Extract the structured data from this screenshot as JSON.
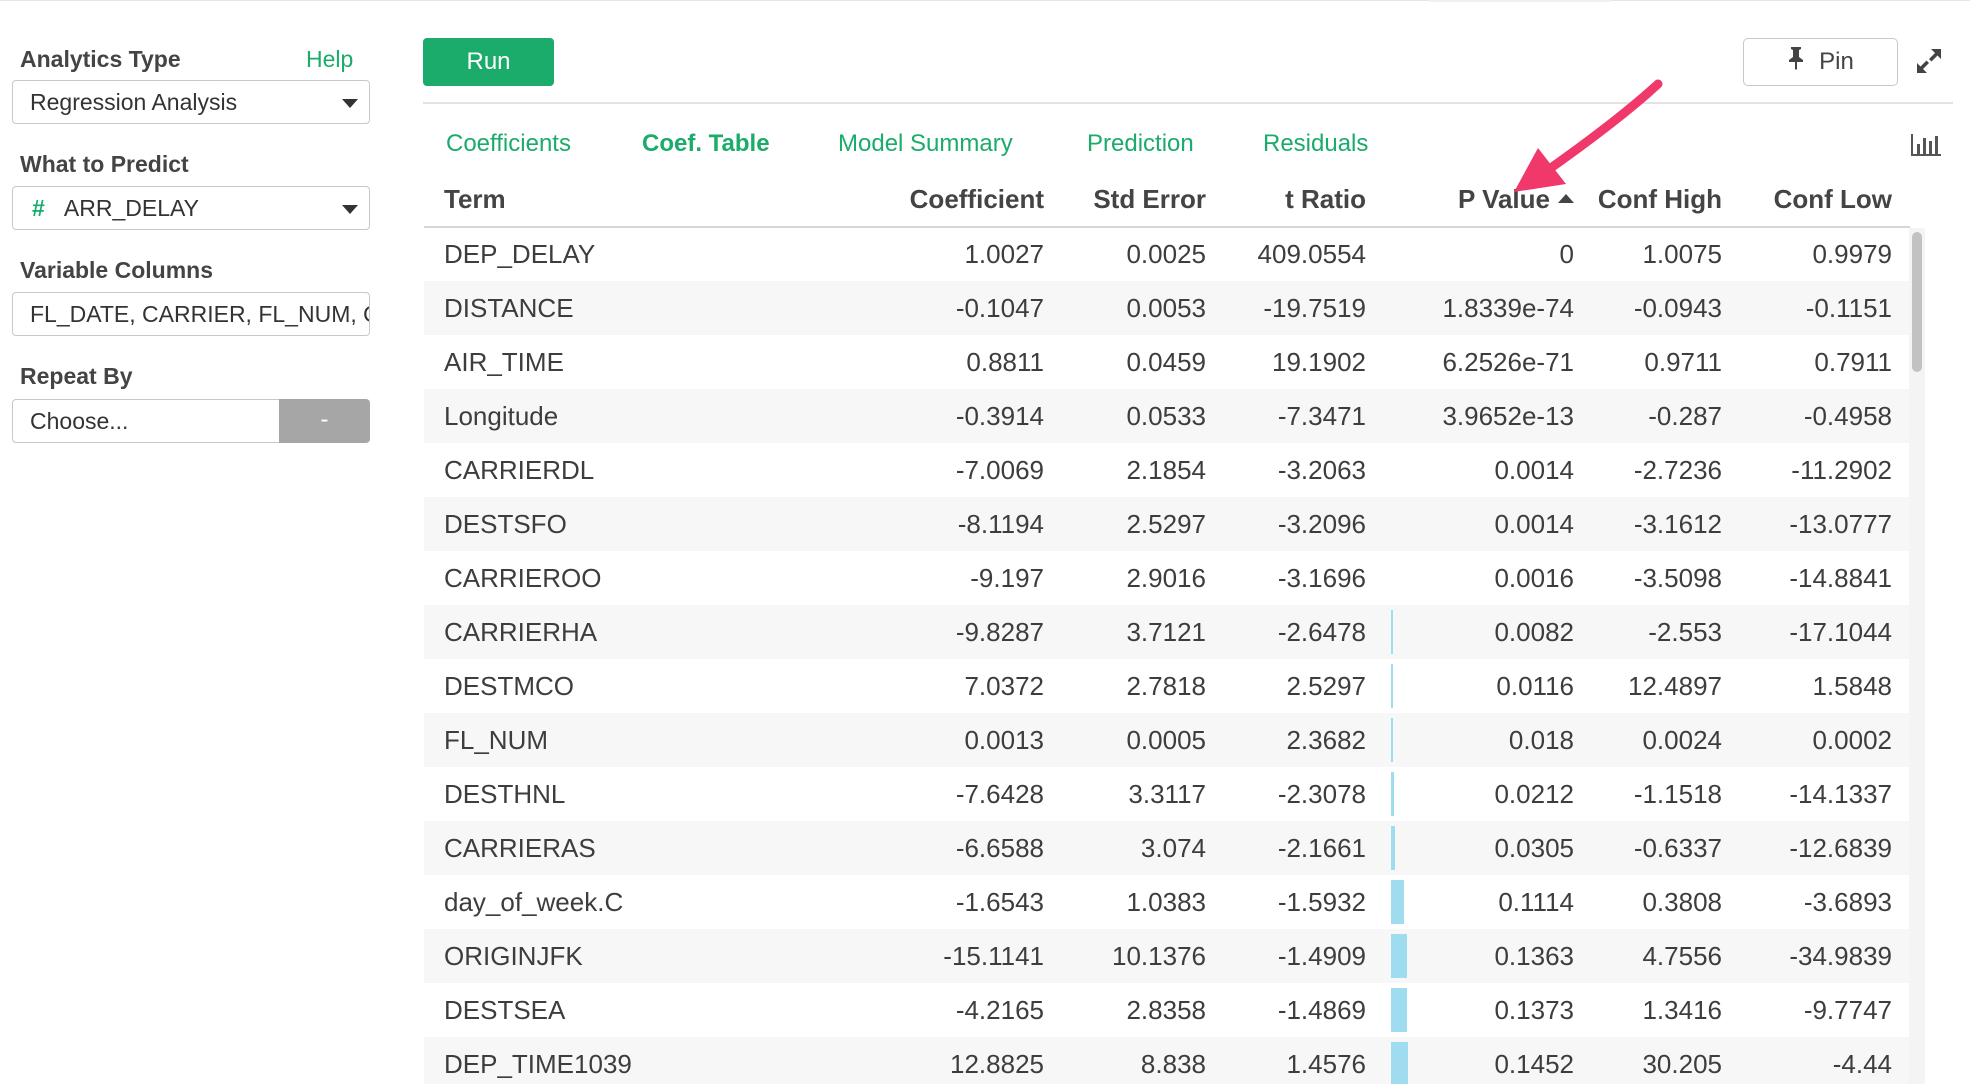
{
  "sidebar": {
    "analytics_type_label": "Analytics Type",
    "help_label": "Help",
    "analytics_type_value": "Regression Analysis",
    "predict_label": "What to Predict",
    "predict_type_glyph": "#",
    "predict_value": "ARR_DELAY",
    "variable_columns_label": "Variable Columns",
    "variable_columns_value": "FL_DATE, CARRIER, FL_NUM, ORIGIN",
    "repeat_by_label": "Repeat By",
    "repeat_by_placeholder": "Choose...",
    "repeat_by_button": "-"
  },
  "header": {
    "run_label": "Run",
    "pin_label": "Pin",
    "pin_icon": "pushpin-icon",
    "expand_icon": "expand-icon"
  },
  "tabs": [
    {
      "label": "Coefficients",
      "active": false
    },
    {
      "label": "Coef. Table",
      "active": true
    },
    {
      "label": "Model Summary",
      "active": false
    },
    {
      "label": "Prediction",
      "active": false
    },
    {
      "label": "Residuals",
      "active": false
    }
  ],
  "chart_icon": "bar-chart-icon",
  "table": {
    "columns": [
      "Term",
      "Coefficient",
      "Std Error",
      "t Ratio",
      "P Value",
      "Conf High",
      "Conf Low"
    ],
    "sorted_by": "P Value",
    "sort_direction": "ascending",
    "rows": [
      [
        "DEP_DELAY",
        "1.0027",
        "0.0025",
        "409.0554",
        "0",
        "1.0075",
        "0.9979"
      ],
      [
        "DISTANCE",
        "-0.1047",
        "0.0053",
        "-19.7519",
        "1.8339e-74",
        "-0.0943",
        "-0.1151"
      ],
      [
        "AIR_TIME",
        "0.8811",
        "0.0459",
        "19.1902",
        "6.2526e-71",
        "0.9711",
        "0.7911"
      ],
      [
        "Longitude",
        "-0.3914",
        "0.0533",
        "-7.3471",
        "3.9652e-13",
        "-0.287",
        "-0.4958"
      ],
      [
        "CARRIERDL",
        "-7.0069",
        "2.1854",
        "-3.2063",
        "0.0014",
        "-2.7236",
        "-11.2902"
      ],
      [
        "DESTSFO",
        "-8.1194",
        "2.5297",
        "-3.2096",
        "0.0014",
        "-3.1612",
        "-13.0777"
      ],
      [
        "CARRIEROO",
        "-9.197",
        "2.9016",
        "-3.1696",
        "0.0016",
        "-3.5098",
        "-14.8841"
      ],
      [
        "CARRIERHA",
        "-9.8287",
        "3.7121",
        "-2.6478",
        "0.0082",
        "-2.553",
        "-17.1044"
      ],
      [
        "DESTMCO",
        "7.0372",
        "2.7818",
        "2.5297",
        "0.0116",
        "12.4897",
        "1.5848"
      ],
      [
        "FL_NUM",
        "0.0013",
        "0.0005",
        "2.3682",
        "0.018",
        "0.0024",
        "0.0002"
      ],
      [
        "DESTHNL",
        "-7.6428",
        "3.3117",
        "-2.3078",
        "0.0212",
        "-1.1518",
        "-14.1337"
      ],
      [
        "CARRIERAS",
        "-6.6588",
        "3.074",
        "-2.1661",
        "0.0305",
        "-0.6337",
        "-12.6839"
      ],
      [
        "day_of_week.C",
        "-1.6543",
        "1.0383",
        "-1.5932",
        "0.1114",
        "0.3808",
        "-3.6893"
      ],
      [
        "ORIGINJFK",
        "-15.1141",
        "10.1376",
        "-1.4909",
        "0.1363",
        "4.7556",
        "-34.9839"
      ],
      [
        "DESTSEA",
        "-4.2165",
        "2.8358",
        "-1.4869",
        "0.1373",
        "1.3416",
        "-9.7747"
      ],
      [
        "DEP_TIME1039",
        "12.8825",
        "8.838",
        "1.4576",
        "0.1452",
        "30.205",
        "-4.44"
      ]
    ]
  },
  "colors": {
    "accent": "#1bab6a",
    "pvalue_bar": "#9fdcef",
    "annotation_arrow": "#f0386b"
  }
}
